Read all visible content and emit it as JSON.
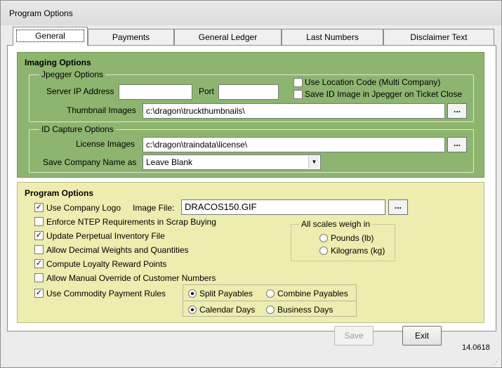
{
  "window": {
    "title": "Program Options"
  },
  "tabs": [
    {
      "label": "General",
      "active": true
    },
    {
      "label": "Payments",
      "active": false
    },
    {
      "label": "General Ledger",
      "active": false
    },
    {
      "label": "Last Numbers",
      "active": false
    },
    {
      "label": "Disclaimer Text",
      "active": false
    }
  ],
  "imaging": {
    "title": "Imaging Options",
    "jpegger": {
      "legend": "Jpegger Options",
      "server_ip_label": "Server IP Address",
      "server_ip_value": "",
      "port_label": "Port",
      "port_value": "",
      "use_location_code_label": "Use Location Code (Multi Company)",
      "use_location_code_checked": false,
      "save_id_image_label": "Save ID Image in Jpegger on Ticket Close",
      "save_id_image_checked": false,
      "thumbnail_label": "Thumbnail Images",
      "thumbnail_value": "c:\\dragon\\truckthumbnails\\",
      "browse_label": "..."
    },
    "id_capture": {
      "legend": "ID Capture Options",
      "license_label": "License Images",
      "license_value": "c:\\dragon\\traindata\\license\\",
      "browse_label": "...",
      "save_company_label": "Save Company Name as",
      "save_company_value": "Leave Blank"
    }
  },
  "program": {
    "title": "Program Options",
    "use_company_logo": {
      "label": "Use Company Logo",
      "checked": true
    },
    "image_file_label": "Image File:",
    "image_file_value": "DRACOS150.GIF",
    "image_browse_label": "...",
    "enforce_ntep": {
      "label": "Enforce NTEP Requirements in Scrap Buying",
      "checked": false
    },
    "update_inventory": {
      "label": "Update Perpetual Inventory File",
      "checked": true
    },
    "allow_decimal": {
      "label": "Allow Decimal Weights and Quantities",
      "checked": false
    },
    "compute_loyalty": {
      "label": "Compute Loyalty Reward Points",
      "checked": true
    },
    "allow_manual_override": {
      "label": "Allow Manual Override of Customer Numbers",
      "checked": false
    },
    "use_commodity_rules": {
      "label": "Use Commodity Payment Rules",
      "checked": true
    },
    "scales": {
      "legend": "All scales weigh in",
      "pounds_label": "Pounds (lb)",
      "kilograms_label": "Kilograms (kg)",
      "selected": "none"
    },
    "payables": {
      "split_label": "Split Payables",
      "combine_label": "Combine Payables",
      "selected": "split",
      "calendar_label": "Calendar Days",
      "business_label": "Business Days",
      "days_selected": "calendar"
    }
  },
  "footer": {
    "save_label": "Save",
    "save_enabled": false,
    "exit_label": "Exit",
    "version": "14.0618"
  }
}
